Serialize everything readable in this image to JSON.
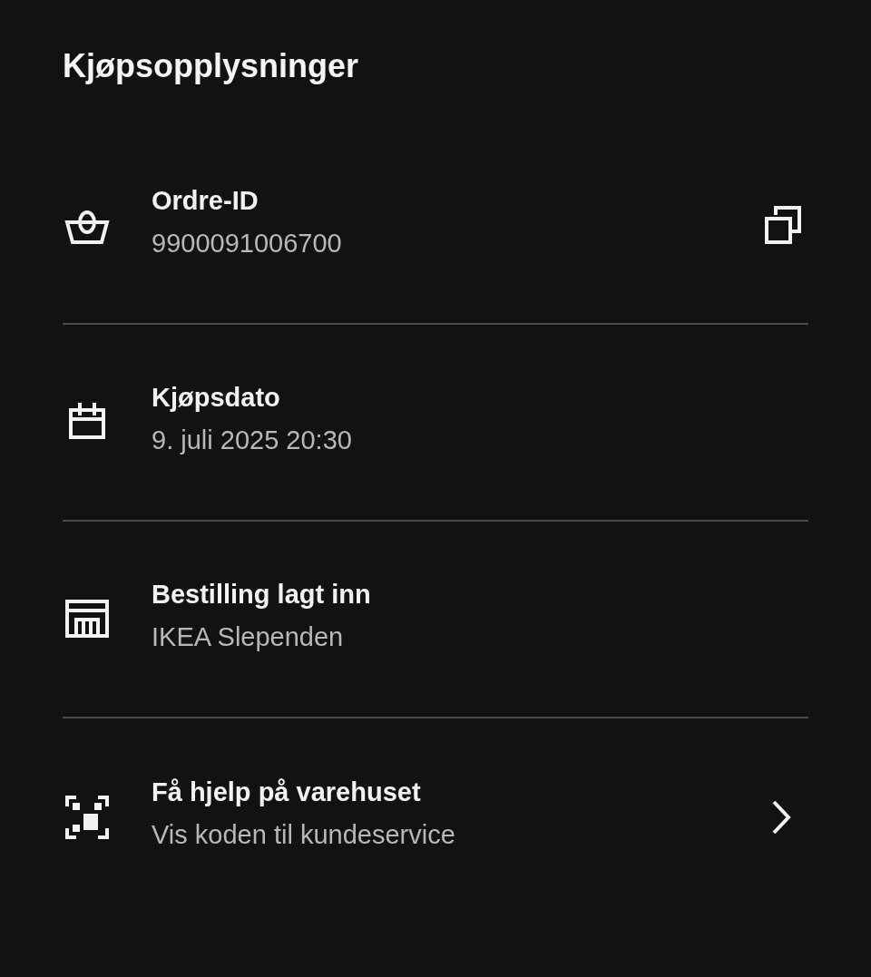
{
  "title": "Kjøpsopplysninger",
  "rows": [
    {
      "kind": "copyable",
      "label": "Ordre-ID",
      "value": "9900091006700"
    },
    {
      "kind": "plain",
      "label": "Kjøpsdato",
      "value": "9. juli 2025 20:30"
    },
    {
      "kind": "plain",
      "label": "Bestilling lagt inn",
      "value": "IKEA Slependen"
    },
    {
      "kind": "link",
      "label": "Få hjelp på varehuset",
      "value": "Vis koden til kundeservice"
    }
  ]
}
